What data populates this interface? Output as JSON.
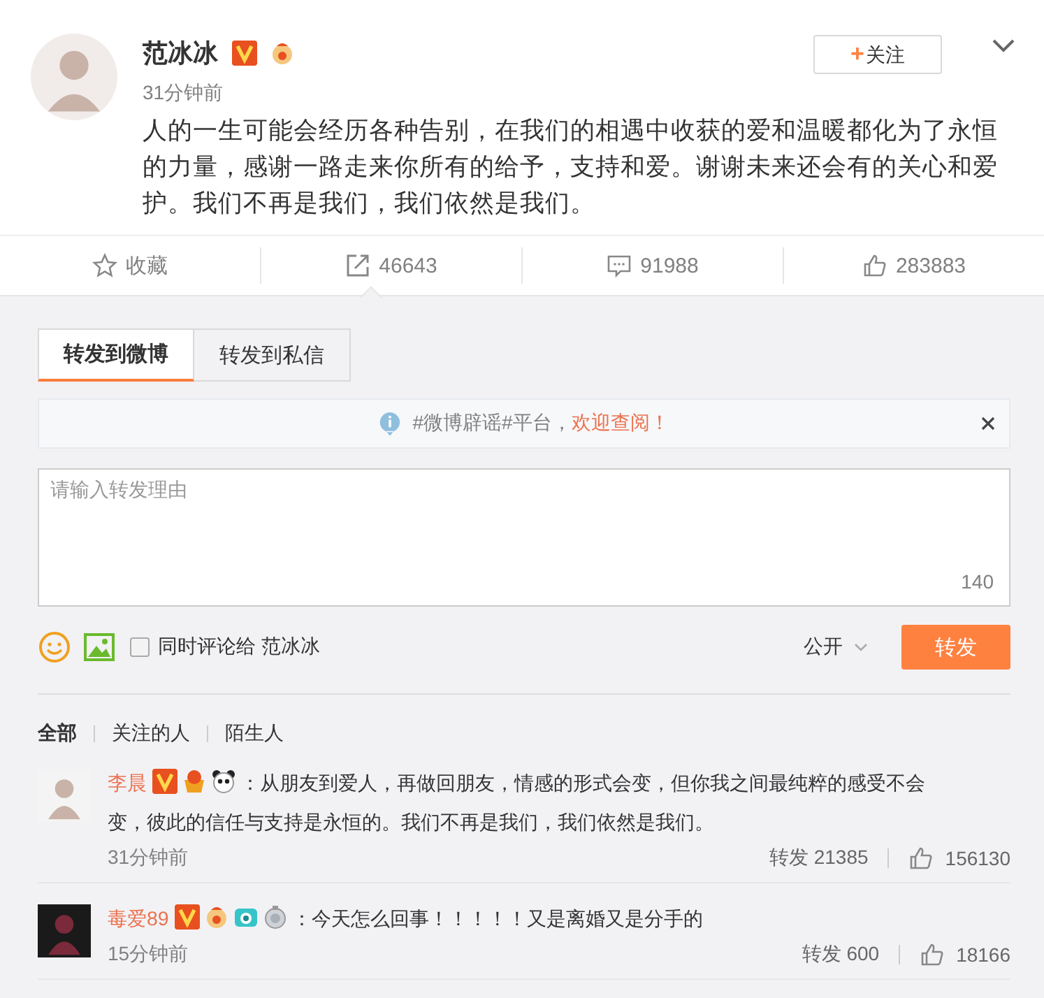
{
  "post": {
    "author": "范冰冰",
    "badges": [
      {
        "kind": "verified"
      },
      {
        "kind": "rooster"
      }
    ],
    "time": "31分钟前",
    "text": "人的一生可能会经历各种告别，在我们的相遇中收获的爱和温暖都化为了永恒的力量，感谢一路走来你所有的给予，支持和爱。谢谢未来还会有的关心和爱护。我们不再是我们，我们依然是我们。",
    "follow": {
      "icon": "+",
      "label": "关注"
    }
  },
  "actions": [
    {
      "kind": "favorite",
      "label": "收藏",
      "selected": false
    },
    {
      "kind": "repost",
      "label": "46643",
      "selected": true
    },
    {
      "kind": "comment",
      "label": "91988",
      "selected": false
    },
    {
      "kind": "like",
      "label": "283883",
      "selected": false
    }
  ],
  "tabs": [
    {
      "label": "转发到微博",
      "selected": true
    },
    {
      "label": "转发到私信",
      "selected": false
    }
  ],
  "notice": {
    "text": "#微博辟谣#平台，",
    "link": "欢迎查阅！"
  },
  "composer": {
    "placeholder": "请输入转发理由",
    "count": "140",
    "also_comment": {
      "label": "同时评论给 范冰冰",
      "checked": false
    },
    "visibility": "公开",
    "submit": "转发"
  },
  "filters": [
    {
      "label": "全部",
      "selected": true
    },
    {
      "label": "关注的人",
      "selected": false
    },
    {
      "label": "陌生人",
      "selected": false
    }
  ],
  "comments": [
    {
      "author": "李晨",
      "badges": [
        {
          "kind": "verified"
        },
        {
          "kind": "medal"
        },
        {
          "kind": "panda"
        }
      ],
      "text": "：从朋友到爱人，再做回朋友，情感的形式会变，但你我之间最纯粹的感受不会变，彼此的信任与支持是永恒的。我们不再是我们，我们依然是我们。",
      "time": "31分钟前",
      "repost": "转发 21385",
      "likes": "156130"
    },
    {
      "author": "毒爱89",
      "badges": [
        {
          "kind": "verified"
        },
        {
          "kind": "rooster"
        },
        {
          "kind": "camera"
        },
        {
          "kind": "silver"
        }
      ],
      "text": "：今天怎么回事！！！！！又是离婚又是分手的",
      "time": "15分钟前",
      "repost": "转发 600",
      "likes": "18166"
    }
  ]
}
